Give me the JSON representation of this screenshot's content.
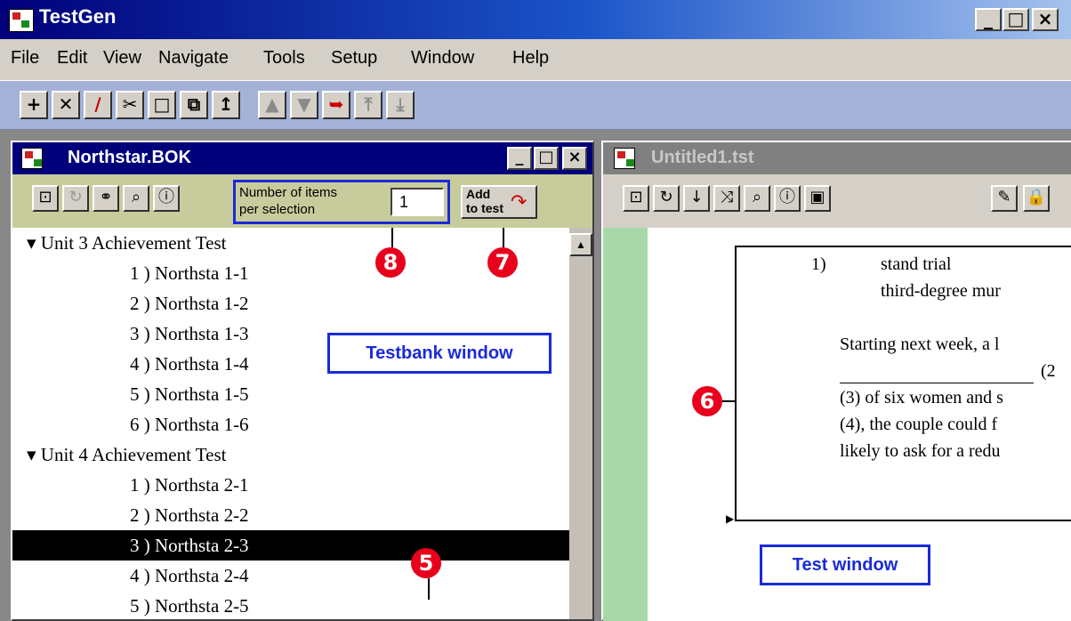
{
  "window": {
    "title": "TestGen"
  },
  "menu": [
    "File",
    "Edit",
    "View",
    "Navigate",
    "Tools",
    "Setup",
    "Window",
    "Help"
  ],
  "toolbar_icons": [
    "new-test-icon",
    "close-test-icon",
    "edit-icon",
    "cut-icon",
    "copy-icon",
    "paste-icon",
    "insert-icon",
    "move-up-icon",
    "move-down-icon",
    "bookmark-icon",
    "move-top-icon",
    "move-bottom-icon"
  ],
  "testbank": {
    "title": "Northstar.BOK",
    "items_label": "Number of items per selection",
    "items_label_l1": "Number of items",
    "items_label_l2": "per selection",
    "items_value": "1",
    "add_btn_l1": "Add",
    "add_btn_l2": "to test",
    "units": [
      {
        "title": "Unit 3 Achievement Test",
        "items": [
          "1 ) Northsta 1-1",
          "2 ) Northsta 1-2",
          "3 ) Northsta 1-3",
          "4 ) Northsta 1-4",
          "5 ) Northsta 1-5",
          "6 ) Northsta 1-6"
        ]
      },
      {
        "title": "Unit 4 Achievement Test",
        "items": [
          "1 ) Northsta 2-1",
          "2 ) Northsta 2-2",
          "3 ) Northsta 2-3",
          "4 ) Northsta 2-4",
          "5 ) Northsta 2-5"
        ]
      }
    ],
    "selected_item": "3 ) Northsta 2-3",
    "window_label": "Testbank window"
  },
  "test": {
    "title": "Untitled1.tst",
    "q_number": "1)",
    "lines": [
      "stand trial",
      "third-degree mur",
      "Starting next week, a l",
      "(2",
      "(3) of six women and s",
      "(4), the couple could f",
      "likely to ask for a redu"
    ],
    "window_label": "Test window"
  },
  "callouts": {
    "c5": "5",
    "c6": "6",
    "c7": "7",
    "c8": "8"
  }
}
